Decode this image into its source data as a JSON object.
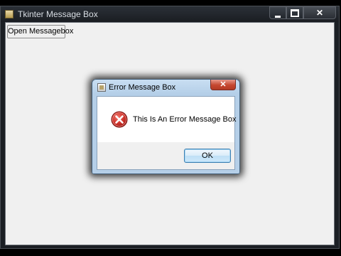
{
  "main_window": {
    "title": "Tkinter Message Box",
    "open_button_label": "Open Messagebox"
  },
  "dialog": {
    "title": "Error Message Box",
    "close_glyph": "✕",
    "message": "This Is An Error Message Box",
    "ok_label": "OK",
    "icon": "error-icon"
  },
  "colors": {
    "error_red": "#c8252a",
    "dialog_frame": "#b5cfe8",
    "ok_border": "#3c7fb1"
  }
}
